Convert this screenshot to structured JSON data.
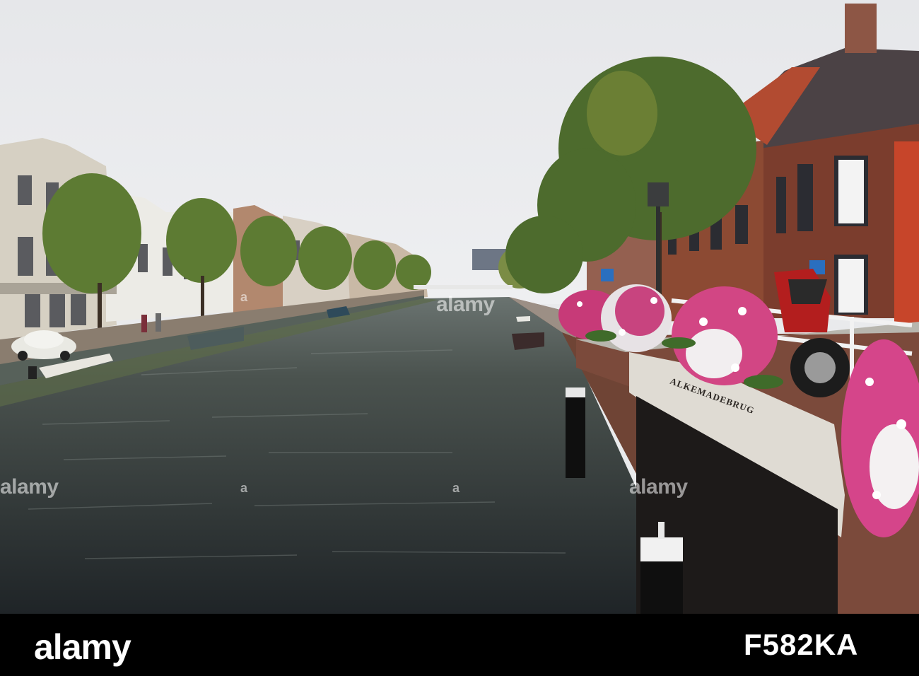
{
  "scene": {
    "description_tags": [
      "canal",
      "bridge",
      "flowers",
      "boats",
      "trees",
      "houses",
      "motorcycle",
      "vintage-car"
    ],
    "bridge_inscription": "ALKEMADEBRUG"
  },
  "watermark": {
    "logo": "alamy",
    "positions_count": 6
  },
  "footer": {
    "brand": "alamy",
    "image_id": "F582KA"
  },
  "colors": {
    "sky": "#e9eaec",
    "water": "#3a3f42",
    "brick": "#8b4a35",
    "footer_bg": "#000000",
    "flower_pink": "#e0468a",
    "tree": "#4d6b2d"
  }
}
